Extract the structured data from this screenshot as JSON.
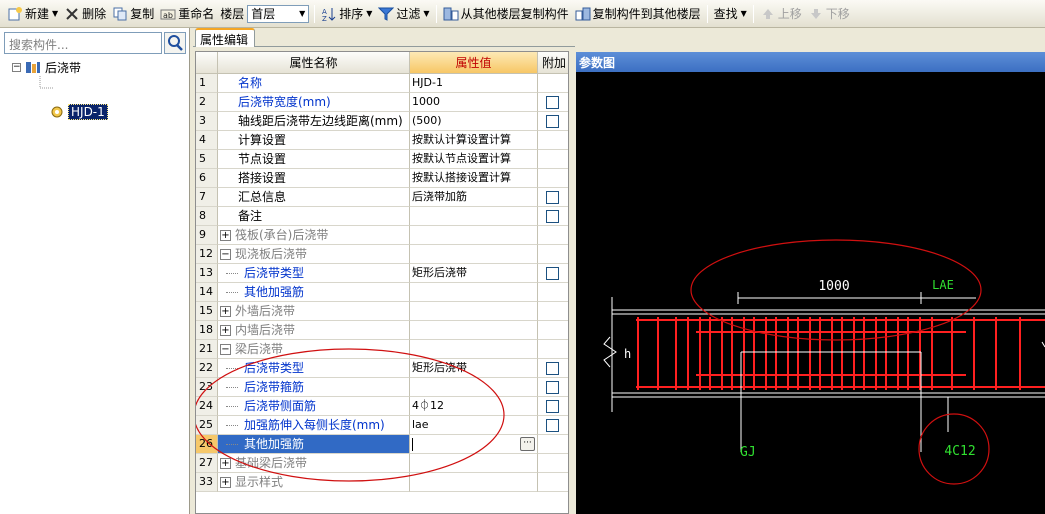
{
  "toolbar": {
    "new": "新建",
    "delete": "删除",
    "copy": "复制",
    "rename": "重命名",
    "floor_label": "楼层",
    "floor_value": "首层",
    "sort": "排序",
    "filter": "过滤",
    "copy_from_floor": "从其他楼层复制构件",
    "copy_to_floor": "复制构件到其他楼层",
    "find": "查找",
    "move_up": "上移",
    "move_down": "下移"
  },
  "left_panel": {
    "search_placeholder": "搜索构件...",
    "tree_root": "后浇带",
    "tree_child": "HJD-1"
  },
  "property_panel": {
    "tab": "属性编辑",
    "headers": {
      "name": "属性名称",
      "value": "属性值",
      "attach": "附加"
    },
    "rows": [
      {
        "num": "1",
        "name": "名称",
        "value": "HJD-1"
      },
      {
        "num": "2",
        "name": "后浇带宽度(mm)",
        "value": "1000"
      },
      {
        "num": "3",
        "name": "轴线距后浇带左边线距离(mm)",
        "value": "(500)"
      },
      {
        "num": "4",
        "name": "计算设置",
        "value": "按默认计算设置计算"
      },
      {
        "num": "5",
        "name": "节点设置",
        "value": "按默认节点设置计算"
      },
      {
        "num": "6",
        "name": "搭接设置",
        "value": "按默认搭接设置计算"
      },
      {
        "num": "7",
        "name": "汇总信息",
        "value": "后浇带加筋"
      },
      {
        "num": "8",
        "name": "备注",
        "value": ""
      },
      {
        "num": "9",
        "name": "筏板(承台)后浇带",
        "value": ""
      },
      {
        "num": "12",
        "name": "现浇板后浇带",
        "value": ""
      },
      {
        "num": "13",
        "name": "后浇带类型",
        "value": "矩形后浇带"
      },
      {
        "num": "14",
        "name": "其他加强筋",
        "value": ""
      },
      {
        "num": "15",
        "name": "外墙后浇带",
        "value": ""
      },
      {
        "num": "18",
        "name": "内墙后浇带",
        "value": ""
      },
      {
        "num": "21",
        "name": "梁后浇带",
        "value": ""
      },
      {
        "num": "22",
        "name": "后浇带类型",
        "value": "矩形后浇带"
      },
      {
        "num": "23",
        "name": "后浇带箍筋",
        "value": ""
      },
      {
        "num": "24",
        "name": "后浇带侧面筋",
        "value": "4⏀12"
      },
      {
        "num": "25",
        "name": "加强筋伸入每侧长度(mm)",
        "value": "lae"
      },
      {
        "num": "26",
        "name": "其他加强筋",
        "value": ""
      },
      {
        "num": "27",
        "name": "基础梁后浇带",
        "value": ""
      },
      {
        "num": "33",
        "name": "显示样式",
        "value": ""
      }
    ]
  },
  "ref_panel": {
    "title": "参数图",
    "dim_width": "1000",
    "dim_lae": "LAE",
    "label_h": "h",
    "label_gj": "GJ",
    "label_rebar": "4C12"
  },
  "colors": {
    "rebar_red": "#ff2020",
    "annotation_red": "#d01010",
    "label_green": "#30e030",
    "selection_blue": "#316ac5"
  }
}
